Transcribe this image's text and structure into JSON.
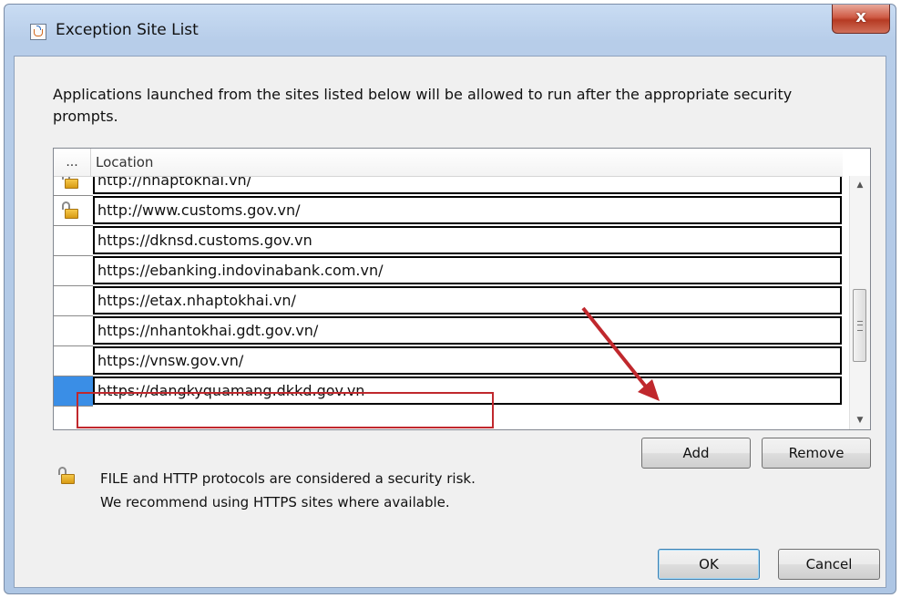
{
  "window": {
    "title": "Exception Site List",
    "close_symbol": "x"
  },
  "description": "Applications launched from the sites listed below will be allowed to run after the appropriate security prompts.",
  "table": {
    "header_icon": "...",
    "header_location": "Location",
    "rows": [
      {
        "url": "http://nhaptokhai.vn/",
        "icon": "unlocked-padlock-icon"
      },
      {
        "url": "http://www.customs.gov.vn/",
        "icon": "unlocked-padlock-icon"
      },
      {
        "url": "https://dknsd.customs.gov.vn",
        "icon": ""
      },
      {
        "url": "https://ebanking.indovinabank.com.vn/",
        "icon": ""
      },
      {
        "url": "https://etax.nhaptokhai.vn/",
        "icon": ""
      },
      {
        "url": "https://nhantokhai.gdt.gov.vn/",
        "icon": ""
      },
      {
        "url": "https://vnsw.gov.vn/",
        "icon": ""
      },
      {
        "url": "https://dangkyquamang.dkkd.gov.vn",
        "icon": "",
        "selected": true,
        "editing": true
      }
    ]
  },
  "buttons": {
    "add": "Add",
    "remove": "Remove",
    "ok": "OK",
    "cancel": "Cancel"
  },
  "notice": {
    "line1": "FILE and HTTP protocols are considered a security risk.",
    "line2": "We recommend using HTTPS sites where available.",
    "icon": "unlocked-padlock-icon"
  },
  "colors": {
    "highlight": "#c0282d",
    "selection": "#3a8ee6"
  }
}
